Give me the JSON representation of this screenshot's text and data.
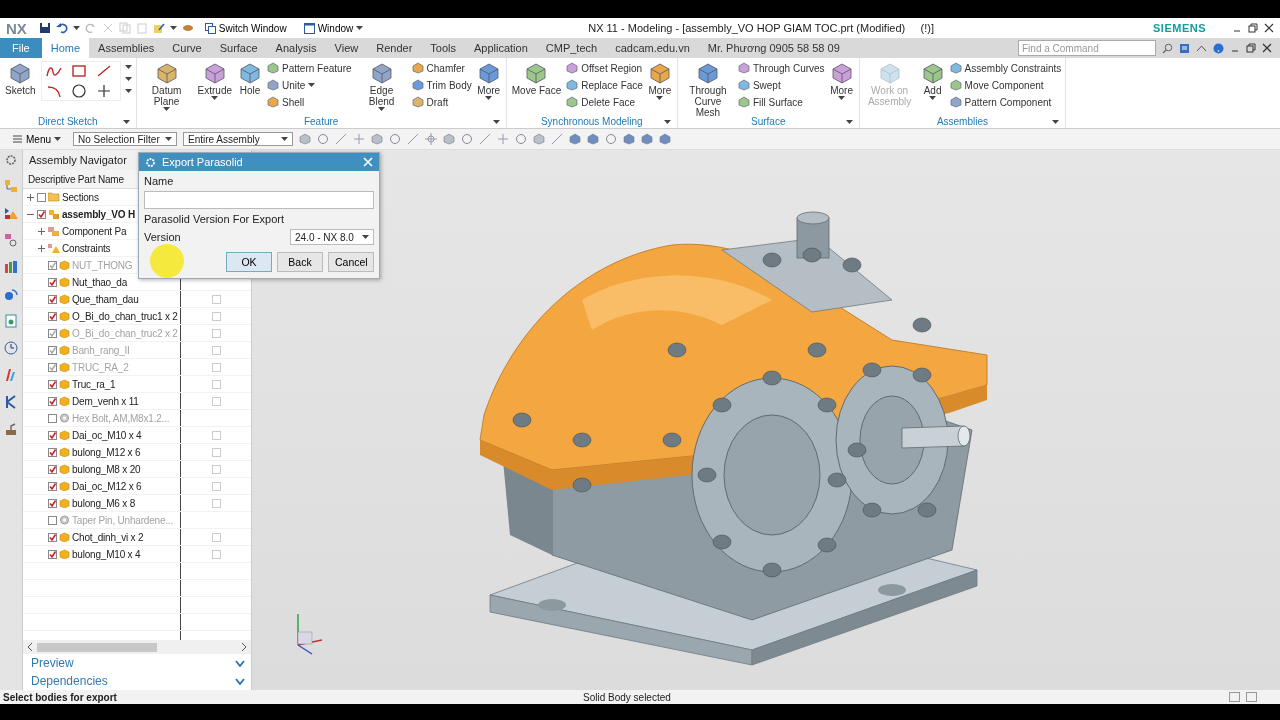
{
  "title_bar": {
    "logo": "NX",
    "switch_window": "Switch Window",
    "window_menu": "Window",
    "title": "NX 11 - Modeling - [assembly_VO HOP GIAM TOC.prt (Modified)     (!)]",
    "brand": "SIEMENS"
  },
  "tabs": [
    {
      "label": "File",
      "kind": "file",
      "selected": false
    },
    {
      "label": "Home",
      "kind": "tab",
      "selected": true
    },
    {
      "label": "Assemblies",
      "kind": "tab",
      "selected": false
    },
    {
      "label": "Curve",
      "kind": "tab",
      "selected": false
    },
    {
      "label": "Surface",
      "kind": "tab",
      "selected": false
    },
    {
      "label": "Analysis",
      "kind": "tab",
      "selected": false
    },
    {
      "label": "View",
      "kind": "tab",
      "selected": false
    },
    {
      "label": "Render",
      "kind": "tab",
      "selected": false
    },
    {
      "label": "Tools",
      "kind": "tab",
      "selected": false
    },
    {
      "label": "Application",
      "kind": "tab",
      "selected": false
    },
    {
      "label": "CMP_tech",
      "kind": "tab",
      "selected": false
    },
    {
      "label": "cadcam.edu.vn",
      "kind": "tab",
      "selected": false
    },
    {
      "label": "Mr. Phương 0905 58 58 09",
      "kind": "tab",
      "selected": false
    }
  ],
  "command_search": {
    "placeholder": "Find a Command"
  },
  "ribbon": {
    "groups": [
      {
        "label": "Direct Sketch",
        "items": [
          {
            "kind": "large",
            "label": "Sketch",
            "dropdown": false,
            "disabled": false
          },
          {
            "kind": "sketch_palette"
          }
        ]
      },
      {
        "label": "Feature",
        "items": [
          {
            "kind": "large",
            "label": "Datum Plane",
            "dropdown": true,
            "disabled": false
          },
          {
            "kind": "large",
            "label": "Extrude",
            "dropdown": true,
            "disabled": false
          },
          {
            "kind": "large",
            "label": "Hole",
            "dropdown": false,
            "disabled": false
          },
          {
            "kind": "stack",
            "items": [
              {
                "label": "Pattern Feature",
                "dropdown": false
              },
              {
                "label": "Unite",
                "dropdown": true
              },
              {
                "label": "Shell",
                "dropdown": false
              }
            ]
          },
          {
            "kind": "large",
            "label": "Edge Blend",
            "dropdown": true,
            "disabled": false
          },
          {
            "kind": "stack",
            "items": [
              {
                "label": "Chamfer",
                "dropdown": false
              },
              {
                "label": "Trim Body",
                "dropdown": false
              },
              {
                "label": "Draft",
                "dropdown": false
              }
            ]
          },
          {
            "kind": "large",
            "label": "More",
            "dropdown": true,
            "disabled": false
          }
        ]
      },
      {
        "label": "Synchronous Modeling",
        "items": [
          {
            "kind": "large",
            "label": "Move Face",
            "dropdown": false,
            "disabled": false
          },
          {
            "kind": "stack",
            "items": [
              {
                "label": "Offset Region",
                "dropdown": false
              },
              {
                "label": "Replace Face",
                "dropdown": false
              },
              {
                "label": "Delete Face",
                "dropdown": false
              }
            ]
          },
          {
            "kind": "large",
            "label": "More",
            "dropdown": true,
            "disabled": false
          }
        ]
      },
      {
        "label": "Surface",
        "items": [
          {
            "kind": "large",
            "label": "Through Curve Mesh",
            "dropdown": false,
            "disabled": false
          },
          {
            "kind": "stack",
            "items": [
              {
                "label": "Through Curves",
                "dropdown": false
              },
              {
                "label": "Swept",
                "dropdown": false
              },
              {
                "label": "Fill Surface",
                "dropdown": false
              }
            ]
          },
          {
            "kind": "large",
            "label": "More",
            "dropdown": true,
            "disabled": false
          }
        ]
      },
      {
        "label": "Assemblies",
        "items": [
          {
            "kind": "large",
            "label": "Work on Assembly",
            "dropdown": false,
            "disabled": true
          },
          {
            "kind": "large",
            "label": "Add",
            "dropdown": true,
            "disabled": false
          },
          {
            "kind": "stack",
            "items": [
              {
                "label": "Assembly Constraints",
                "dropdown": false
              },
              {
                "label": "Move Component",
                "dropdown": false
              },
              {
                "label": "Pattern Component",
                "dropdown": false
              }
            ]
          }
        ]
      }
    ]
  },
  "toolbar": {
    "menu": "Menu",
    "selection_filter": "No Selection Filter",
    "scope": "Entire Assembly"
  },
  "navigator": {
    "title": "Assembly Navigator",
    "column": "Descriptive Part Name",
    "tree": [
      {
        "label": "Sections",
        "kind": "folder",
        "checked": false,
        "dimmed": false,
        "expanded": false
      },
      {
        "label": "assembly_VO H",
        "kind": "assembly",
        "checked": true,
        "dimmed": false,
        "expanded": true,
        "children": [
          {
            "label": "Component Pa",
            "kind": "patterns",
            "dimmed": false,
            "expanded": false
          },
          {
            "label": "Constraints",
            "kind": "constraints",
            "dimmed": false,
            "expanded": false
          },
          {
            "label": "NUT_THONG",
            "kind": "part",
            "checked": true,
            "dimmed": true
          },
          {
            "label": "Nut_thao_da",
            "kind": "part",
            "checked": true,
            "dimmed": false
          },
          {
            "label": "Que_tham_dau",
            "kind": "part",
            "checked": true,
            "dimmed": false,
            "column_box": {
              "checked": false
            }
          },
          {
            "label": "O_Bi_do_chan_truc1 x 2",
            "kind": "part",
            "checked": true,
            "dimmed": false,
            "column_box": {
              "checked": false
            }
          },
          {
            "label": "O_Bi_do_chan_truc2 x 2",
            "kind": "part",
            "checked": true,
            "dimmed": true,
            "column_box": {
              "checked": false
            }
          },
          {
            "label": "Banh_rang_II",
            "kind": "part",
            "checked": true,
            "dimmed": true,
            "column_box": {
              "checked": false
            }
          },
          {
            "label": "TRUC_RA_2",
            "kind": "part",
            "checked": true,
            "dimmed": true,
            "column_box": {
              "checked": false
            }
          },
          {
            "label": "Truc_ra_1",
            "kind": "part",
            "checked": true,
            "dimmed": false,
            "column_box": {
              "checked": false
            }
          },
          {
            "label": "Dem_venh x 11",
            "kind": "part",
            "checked": true,
            "dimmed": false,
            "column_box": {
              "checked": false
            }
          },
          {
            "label": "Hex Bolt, AM,M8x1.2...",
            "kind": "library",
            "checked": false,
            "dimmed": true
          },
          {
            "label": "Dai_oc_M10 x 4",
            "kind": "part",
            "checked": true,
            "dimmed": false,
            "column_box": {
              "checked": false
            }
          },
          {
            "label": "bulong_M12 x 6",
            "kind": "part",
            "checked": true,
            "dimmed": false,
            "column_box": {
              "checked": false
            }
          },
          {
            "label": "bulong_M8 x 20",
            "kind": "part",
            "checked": true,
            "dimmed": false,
            "column_box": {
              "checked": false
            }
          },
          {
            "label": "Dai_oc_M12 x 6",
            "kind": "part",
            "checked": true,
            "dimmed": false,
            "column_box": {
              "checked": false
            }
          },
          {
            "label": "bulong_M6 x 8",
            "kind": "part",
            "checked": true,
            "dimmed": false,
            "column_box": {
              "checked": false
            }
          },
          {
            "label": "Taper Pin, Unhardene...",
            "kind": "library",
            "checked": false,
            "dimmed": true
          },
          {
            "label": "Chot_dinh_vi x 2",
            "kind": "part",
            "checked": true,
            "dimmed": false,
            "column_box": {
              "checked": false
            }
          },
          {
            "label": "bulong_M10 x 4",
            "kind": "part",
            "checked": true,
            "dimmed": false,
            "column_box": {
              "checked": false
            }
          }
        ]
      }
    ],
    "sections": [
      {
        "label": "Preview",
        "expanded": false
      },
      {
        "label": "Dependencies",
        "expanded": false
      }
    ]
  },
  "dialog": {
    "title": "Export Parasolid",
    "name_label": "Name",
    "version_heading": "Parasolid Version For Export",
    "version_label": "Version",
    "version": "24.0 - NX 8.0",
    "buttons": [
      "OK",
      "Back",
      "Cancel"
    ]
  },
  "status_bar": {
    "prompt": "Select bodies for export",
    "message": "Solid Body selected"
  }
}
